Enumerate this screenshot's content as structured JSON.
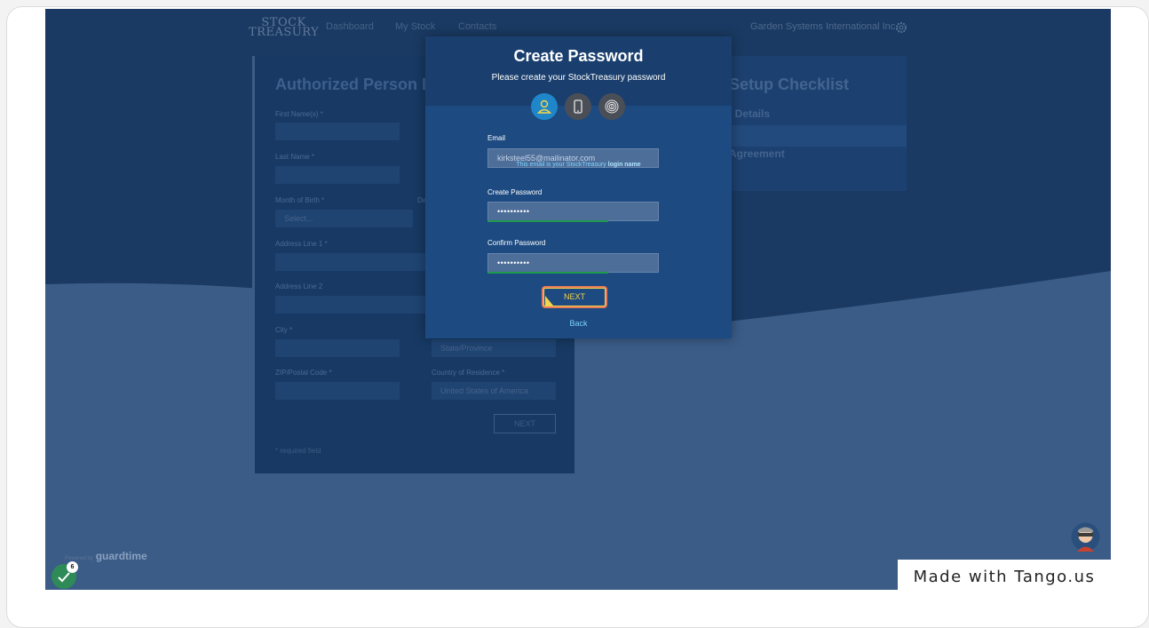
{
  "header": {
    "logo_line1": "STOCK",
    "logo_line2": "TREASURY",
    "nav": [
      "Dashboard",
      "My Stock",
      "Contacts"
    ],
    "company": "Garden Systems International Inc."
  },
  "background_form": {
    "title": "Authorized Person Da",
    "labels": {
      "first_name": "First Name(s) *",
      "last_name": "Last Name *",
      "month_of_birth": "Month of Birth *",
      "day_of_birth": "Da",
      "address1": "Address Line 1 *",
      "address2": "Address Line 2",
      "city": "City *",
      "zip": "ZIP/Postal Code *",
      "country": "Country of Residence *"
    },
    "month_placeholder": "Select...",
    "state_placeholder": "State/Province",
    "country_value": "United States of America",
    "next_label": "NEXT",
    "required_note": "* required field"
  },
  "checklist": {
    "title": "Setup Checklist",
    "items": [
      "l Details",
      "Agreement"
    ]
  },
  "modal": {
    "title": "Create Password",
    "subtitle": "Please create your StockTreasury password",
    "steps": [
      {
        "icon": "user-icon",
        "active": true
      },
      {
        "icon": "phone-icon",
        "active": false
      },
      {
        "icon": "fingerprint-icon",
        "active": false
      }
    ],
    "email_label": "Email",
    "email_value": "kirksteel55@mailinator.com",
    "hint_prefix": "This email is your StockTreasury ",
    "hint_bold": "login name",
    "create_password_label": "Create Password",
    "create_password_value": "••••••••••",
    "confirm_password_label": "Confirm Password",
    "confirm_password_value": "••••••••••",
    "next_label": "NEXT",
    "back_label": "Back"
  },
  "footer": {
    "powered_by": "Powered by",
    "brand": "guardtime"
  },
  "tango": {
    "made_with": "Made with Tango.us",
    "badge_count": "6"
  },
  "colors": {
    "app_bg": "#1a3a63",
    "modal_bg": "#1d4a80",
    "accent_link": "#7dd3ff",
    "next_highlight": "#e77b5a",
    "next_text": "#f4d44a",
    "strength_bar": "#1e9a4e"
  }
}
